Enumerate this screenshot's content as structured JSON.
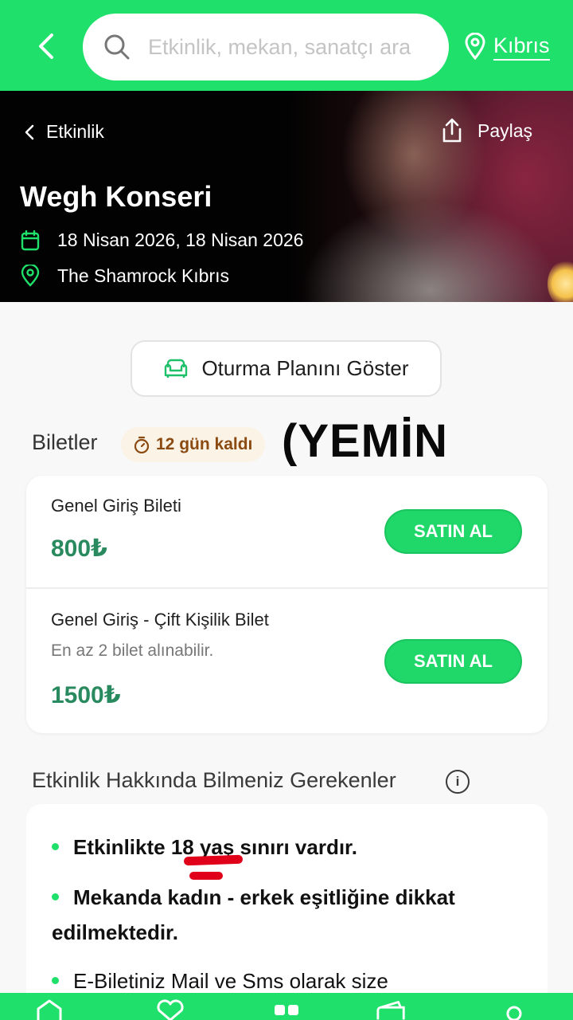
{
  "search": {
    "placeholder": "Etkinlik, mekan, sanatçı ara"
  },
  "location": {
    "label": "Kıbrıs"
  },
  "hero": {
    "breadcrumb": "Etkinlik",
    "share_label": "Paylaş",
    "title": "Wegh Konseri",
    "date": "18 Nisan 2026, 18 Nisan 2026",
    "venue": "The Shamrock Kıbrıs"
  },
  "seat_plan_label": "Oturma Planını Göster",
  "tickets": {
    "heading": "Biletler",
    "countdown": "12 gün kaldı",
    "overlay_text": "(YEMİN",
    "items": [
      {
        "name": "Genel Giriş Bileti",
        "note": "",
        "price": "800₺",
        "button": "SATIN AL"
      },
      {
        "name": "Genel Giriş - Çift Kişilik Bilet",
        "note": "En az 2 bilet alınabilir.",
        "price": "1500₺",
        "button": "SATIN AL"
      }
    ]
  },
  "info": {
    "heading": "Etkinlik Hakkında Bilmeniz Gerekenler",
    "info_icon": "i",
    "bullets": [
      "Etkinlikte 18 yaş sınırı vardır.",
      "Mekanda kadın - erkek eşitliğine dikkat",
      "edilmektedir.",
      "E-Biletiniz Mail ve Sms olarak size"
    ]
  },
  "icons": {
    "back": "chevron-left-icon",
    "search": "search-icon",
    "location": "map-pin-icon",
    "share": "share-icon",
    "calendar": "calendar-icon",
    "seat": "sofa-icon",
    "timer": "timer-icon"
  },
  "colors": {
    "brand_green": "#1ee06a",
    "price_green": "#2a8a5f",
    "countdown_text": "#8a4a12"
  }
}
